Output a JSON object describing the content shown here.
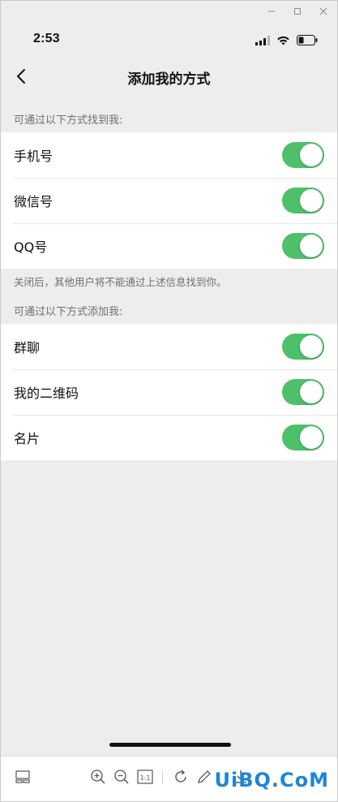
{
  "statusbar": {
    "time": "2:53"
  },
  "navbar": {
    "title": "添加我的方式"
  },
  "find_section": {
    "header": "可通过以下方式找到我:",
    "items": [
      {
        "label": "手机号",
        "enabled": true
      },
      {
        "label": "微信号",
        "enabled": true
      },
      {
        "label": "QQ号",
        "enabled": true
      }
    ],
    "note": "关闭后，其他用户将不能通过上述信息找到你。"
  },
  "add_section": {
    "header": "可通过以下方式添加我:",
    "items": [
      {
        "label": "群聊",
        "enabled": true
      },
      {
        "label": "我的二维码",
        "enabled": true
      },
      {
        "label": "名片",
        "enabled": true
      }
    ]
  },
  "watermark": "UiBQ.CoM",
  "colors": {
    "toggle_on": "#4fc06a",
    "background": "#ededed",
    "watermark": "#1c86d6"
  }
}
